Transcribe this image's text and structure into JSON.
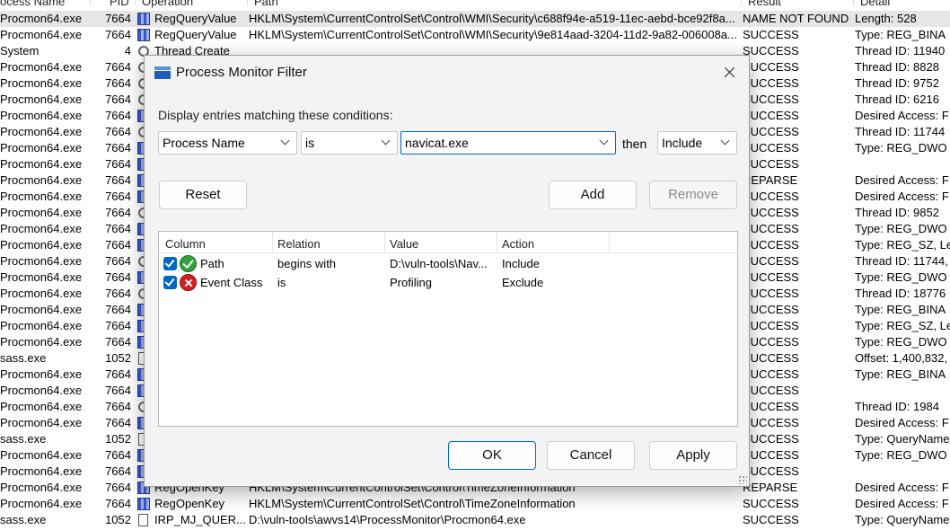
{
  "log": {
    "columns": [
      "ocess Name",
      "PID",
      "Operation",
      "Path",
      "Result",
      "Detail"
    ],
    "rows": [
      {
        "proc": "Procmon64.exe",
        "pid": "7664",
        "icon": "registry-icon",
        "op": "RegQueryValue",
        "path": "HKLM\\System\\CurrentControlSet\\Control\\WMI\\Security\\c688f94e-a519-11ec-aebd-bce92f8a...",
        "result": "NAME NOT FOUND",
        "detail": "Length: 528",
        "hl": true
      },
      {
        "proc": "Procmon64.exe",
        "pid": "7664",
        "icon": "registry-icon",
        "op": "RegQueryValue",
        "path": "HKLM\\System\\CurrentControlSet\\Control\\WMI\\Security\\9e814aad-3204-11d2-9a82-006008a...",
        "result": "SUCCESS",
        "detail": "Type: REG_BINA"
      },
      {
        "proc": "System",
        "pid": "4",
        "icon": "thread-icon",
        "op": "Thread Create",
        "path": "",
        "result": "SUCCESS",
        "detail": "Thread ID: 11940"
      },
      {
        "proc": "Procmon64.exe",
        "pid": "7664",
        "icon": "thread-icon",
        "op": "",
        "path": "",
        "result": "SUCCESS",
        "detail": "Thread ID: 8828"
      },
      {
        "proc": "Procmon64.exe",
        "pid": "7664",
        "icon": "thread-icon",
        "op": "",
        "path": "",
        "result": "SUCCESS",
        "detail": "Thread ID: 9752"
      },
      {
        "proc": "Procmon64.exe",
        "pid": "7664",
        "icon": "thread-icon",
        "op": "",
        "path": "",
        "result": "SUCCESS",
        "detail": "Thread ID: 6216"
      },
      {
        "proc": "Procmon64.exe",
        "pid": "7664",
        "icon": "registry-icon",
        "op": "",
        "path": "",
        "result": "SUCCESS",
        "detail": "Desired Access: F"
      },
      {
        "proc": "Procmon64.exe",
        "pid": "7664",
        "icon": "thread-icon",
        "op": "",
        "path": "",
        "result": "SUCCESS",
        "detail": "Thread ID: 11744"
      },
      {
        "proc": "Procmon64.exe",
        "pid": "7664",
        "icon": "registry-icon",
        "op": "",
        "path": "",
        "result": "SUCCESS",
        "detail": "Type: REG_DWO"
      },
      {
        "proc": "Procmon64.exe",
        "pid": "7664",
        "icon": "registry-icon",
        "op": "",
        "path": "",
        "result": "SUCCESS",
        "detail": ""
      },
      {
        "proc": "Procmon64.exe",
        "pid": "7664",
        "icon": "registry-icon",
        "op": "",
        "path": "",
        "result": "REPARSE",
        "detail": "Desired Access: F"
      },
      {
        "proc": "Procmon64.exe",
        "pid": "7664",
        "icon": "registry-icon",
        "op": "",
        "path": "",
        "result": "SUCCESS",
        "detail": "Desired Access: F"
      },
      {
        "proc": "Procmon64.exe",
        "pid": "7664",
        "icon": "thread-icon",
        "op": "",
        "path": "",
        "result": "SUCCESS",
        "detail": "Thread ID: 9852"
      },
      {
        "proc": "Procmon64.exe",
        "pid": "7664",
        "icon": "registry-icon",
        "op": "",
        "path": "",
        "result": "SUCCESS",
        "detail": "Type: REG_DWO"
      },
      {
        "proc": "Procmon64.exe",
        "pid": "7664",
        "icon": "registry-icon",
        "op": "",
        "path": "",
        "result": "SUCCESS",
        "detail": "Type: REG_SZ, Le"
      },
      {
        "proc": "Procmon64.exe",
        "pid": "7664",
        "icon": "thread-icon",
        "op": "",
        "path": "",
        "result": "SUCCESS",
        "detail": "Thread ID: 11744,"
      },
      {
        "proc": "Procmon64.exe",
        "pid": "7664",
        "icon": "registry-icon",
        "op": "",
        "path": "",
        "result": "SUCCESS",
        "detail": "Type: REG_DWO"
      },
      {
        "proc": "Procmon64.exe",
        "pid": "7664",
        "icon": "thread-icon",
        "op": "",
        "path": "",
        "result": "SUCCESS",
        "detail": "Thread ID: 18776"
      },
      {
        "proc": "Procmon64.exe",
        "pid": "7664",
        "icon": "registry-icon",
        "op": "",
        "path": "",
        "result": "SUCCESS",
        "detail": "Type: REG_BINA"
      },
      {
        "proc": "Procmon64.exe",
        "pid": "7664",
        "icon": "registry-icon",
        "op": "",
        "path": "",
        "result": "SUCCESS",
        "detail": "Type: REG_SZ, Le"
      },
      {
        "proc": "Procmon64.exe",
        "pid": "7664",
        "icon": "registry-icon",
        "op": "",
        "path": "",
        "result": "SUCCESS",
        "detail": "Type: REG_DWO"
      },
      {
        "proc": "sass.exe",
        "pid": "1052",
        "icon": "file-icon",
        "op": "",
        "path": "",
        "result": "SUCCESS",
        "detail": "Offset: 1,400,832, L"
      },
      {
        "proc": "Procmon64.exe",
        "pid": "7664",
        "icon": "registry-icon",
        "op": "",
        "path": "",
        "result": "SUCCESS",
        "detail": "Type: REG_BINA"
      },
      {
        "proc": "Procmon64.exe",
        "pid": "7664",
        "icon": "registry-icon",
        "op": "",
        "path": "",
        "result": "SUCCESS",
        "detail": ""
      },
      {
        "proc": "Procmon64.exe",
        "pid": "7664",
        "icon": "thread-icon",
        "op": "",
        "path": "",
        "result": "SUCCESS",
        "detail": "Thread ID: 1984"
      },
      {
        "proc": "Procmon64.exe",
        "pid": "7664",
        "icon": "registry-icon",
        "op": "",
        "path": "",
        "result": "SUCCESS",
        "detail": "Desired Access: F"
      },
      {
        "proc": "sass.exe",
        "pid": "1052",
        "icon": "file-icon",
        "op": "",
        "path": "",
        "result": "SUCCESS",
        "detail": "Type: QueryName"
      },
      {
        "proc": "Procmon64.exe",
        "pid": "7664",
        "icon": "registry-icon",
        "op": "",
        "path": "",
        "result": "SUCCESS",
        "detail": "Type: REG_DWO"
      },
      {
        "proc": "Procmon64.exe",
        "pid": "7664",
        "icon": "registry-icon",
        "op": "",
        "path": "",
        "result": "SUCCESS",
        "detail": ""
      },
      {
        "proc": "Procmon64.exe",
        "pid": "7664",
        "icon": "registry-icon",
        "op": "RegOpenKey",
        "path": "HKLM\\System\\CurrentControlSet\\Control\\TimeZoneInformation",
        "result": "REPARSE",
        "detail": "Desired Access: F"
      },
      {
        "proc": "Procmon64.exe",
        "pid": "7664",
        "icon": "registry-icon",
        "op": "RegOpenKey",
        "path": "HKLM\\System\\CurrentControlSet\\Control\\TimeZoneInformation",
        "result": "SUCCESS",
        "detail": "Desired Access: F"
      },
      {
        "proc": "sass.exe",
        "pid": "1052",
        "icon": "file-icon",
        "op": "IRP_MJ_QUER...",
        "path": "D:\\vuln-tools\\awvs14\\ProcessMonitor\\Procmon64.exe",
        "result": "SUCCESS",
        "detail": "Type: QueryName"
      }
    ]
  },
  "dialog": {
    "title": "Process Monitor Filter",
    "prompt": "Display entries matching these conditions:",
    "column_select": "Process Name",
    "relation_select": "is",
    "value_input": "navicat.exe",
    "then_label": "then",
    "action_select": "Include",
    "reset_label": "Reset",
    "add_label": "Add",
    "remove_label": "Remove",
    "list_headers": [
      "Column",
      "Relation",
      "Value",
      "Action"
    ],
    "filters": [
      {
        "enabled": true,
        "type": "include",
        "column": "Path",
        "relation": "begins with",
        "value": "D:\\vuln-tools\\Nav...",
        "action": "Include"
      },
      {
        "enabled": true,
        "type": "exclude",
        "column": "Event Class",
        "relation": "is",
        "value": "Profiling",
        "action": "Exclude"
      }
    ],
    "ok_label": "OK",
    "cancel_label": "Cancel",
    "apply_label": "Apply"
  }
}
